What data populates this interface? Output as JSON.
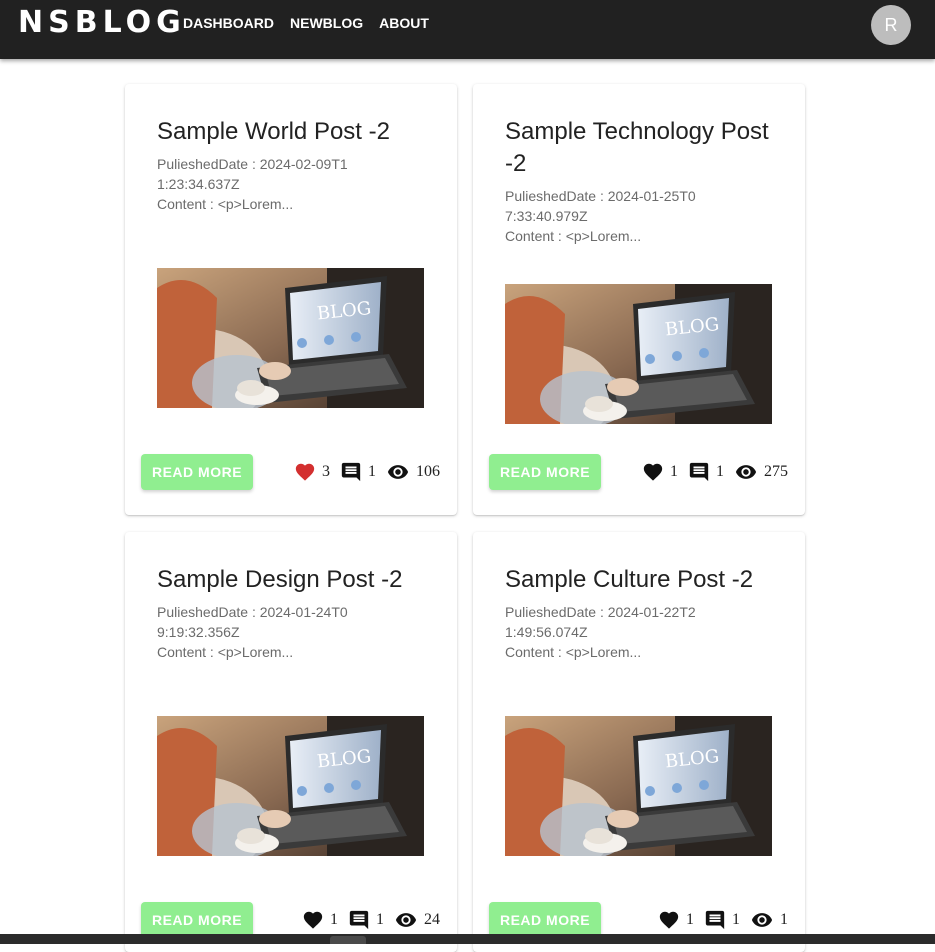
{
  "app": {
    "brand": "NSBLOG",
    "nav": [
      "DASHBOARD",
      "NEWBLOG",
      "ABOUT"
    ],
    "avatar_initial": "R"
  },
  "colors": {
    "appbar": "#212121",
    "button": "#90ee90",
    "liked_heart": "#d32f2f"
  },
  "posts": [
    {
      "title": "Sample World Post -2",
      "date": "PulieshedDate : 2024-02-09T11:23:34.637Z",
      "content": "Content : <p>Lorem...",
      "read_more": "READ MORE",
      "likes": "3",
      "liked": true,
      "comments": "1",
      "views": "106"
    },
    {
      "title": "Sample Technology Post -2",
      "date": "PulieshedDate : 2024-01-25T07:33:40.979Z",
      "content": "Content : <p>Lorem...",
      "read_more": "READ MORE",
      "likes": "1",
      "liked": false,
      "comments": "1",
      "views": "275"
    },
    {
      "title": "Sample Design Post -2",
      "date": "PulieshedDate : 2024-01-24T09:19:32.356Z",
      "content": "Content : <p>Lorem...",
      "read_more": "READ MORE",
      "likes": "1",
      "liked": false,
      "comments": "1",
      "views": "24"
    },
    {
      "title": "Sample Culture Post -2",
      "date": "PulieshedDate : 2024-01-22T21:49:56.074Z",
      "content": "Content : <p>Lorem...",
      "read_more": "READ MORE",
      "likes": "1",
      "liked": false,
      "comments": "1",
      "views": "1"
    }
  ],
  "image": {
    "screen_text": "BLOG"
  }
}
